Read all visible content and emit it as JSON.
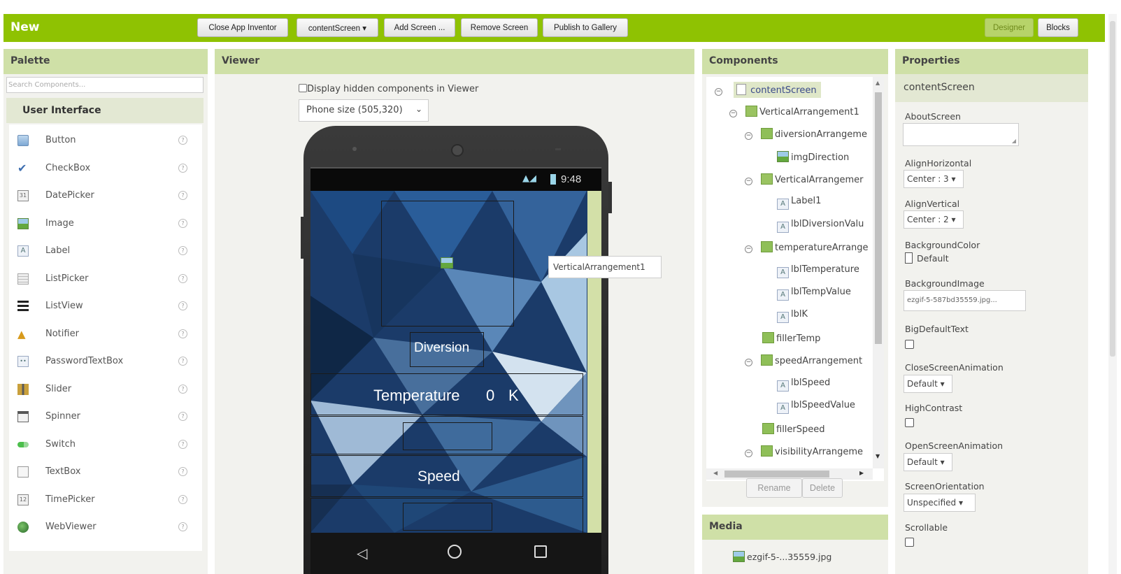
{
  "toolbar": {
    "brand": "New",
    "close_app": "Close App Inventor",
    "screen_select": "contentScreen ▾",
    "add_screen": "Add Screen ...",
    "remove_screen": "Remove Screen",
    "publish": "Publish to Gallery",
    "designer": "Designer",
    "blocks": "Blocks"
  },
  "palette": {
    "title": "Palette",
    "search_placeholder": "Search Components...",
    "category": "User Interface",
    "items": [
      {
        "label": "Button",
        "icon": "button-icon"
      },
      {
        "label": "CheckBox",
        "icon": "checkbox-icon"
      },
      {
        "label": "DatePicker",
        "icon": "datepicker-icon"
      },
      {
        "label": "Image",
        "icon": "image-icon"
      },
      {
        "label": "Label",
        "icon": "label-icon"
      },
      {
        "label": "ListPicker",
        "icon": "listpicker-icon"
      },
      {
        "label": "ListView",
        "icon": "listview-icon"
      },
      {
        "label": "Notifier",
        "icon": "notifier-icon"
      },
      {
        "label": "PasswordTextBox",
        "icon": "password-icon"
      },
      {
        "label": "Slider",
        "icon": "slider-icon"
      },
      {
        "label": "Spinner",
        "icon": "spinner-icon"
      },
      {
        "label": "Switch",
        "icon": "switch-icon"
      },
      {
        "label": "TextBox",
        "icon": "textbox-icon"
      },
      {
        "label": "TimePicker",
        "icon": "timepicker-icon"
      },
      {
        "label": "WebViewer",
        "icon": "webviewer-icon"
      }
    ]
  },
  "viewer": {
    "title": "Viewer",
    "display_hidden": "Display hidden components in Viewer",
    "phone_size": "Phone size (505,320)",
    "status_time": "9:48",
    "diversion_label": "Diversion",
    "temperature_label": "Temperature",
    "temperature_value": "0",
    "temperature_unit": "K",
    "speed_label": "Speed",
    "tooltip": "VerticalArrangement1"
  },
  "components": {
    "title": "Components",
    "tree": [
      {
        "label": "contentScreen",
        "type": "screen",
        "toggle": "⊟"
      },
      {
        "label": "VerticalArrangement1",
        "type": "varr",
        "toggle": "⊟"
      },
      {
        "label": "diversionArrangeme",
        "type": "arr",
        "toggle": "⊟"
      },
      {
        "label": "imgDirection",
        "type": "img",
        "toggle": ""
      },
      {
        "label": "VerticalArrangemer",
        "type": "varr",
        "toggle": "⊟"
      },
      {
        "label": "Label1",
        "type": "lab",
        "toggle": ""
      },
      {
        "label": "lblDiversionValu",
        "type": "lab",
        "toggle": ""
      },
      {
        "label": "temperatureArrange",
        "type": "arr",
        "toggle": "⊟"
      },
      {
        "label": "lblTemperature",
        "type": "lab",
        "toggle": ""
      },
      {
        "label": "lblTempValue",
        "type": "lab",
        "toggle": ""
      },
      {
        "label": "lblK",
        "type": "lab",
        "toggle": ""
      },
      {
        "label": "fillerTemp",
        "type": "arr",
        "toggle": ""
      },
      {
        "label": "speedArrangement",
        "type": "arr",
        "toggle": "⊟"
      },
      {
        "label": "lblSpeed",
        "type": "lab",
        "toggle": ""
      },
      {
        "label": "lblSpeedValue",
        "type": "lab",
        "toggle": ""
      },
      {
        "label": "fillerSpeed",
        "type": "arr",
        "toggle": ""
      },
      {
        "label": "visibilityArrangeme",
        "type": "arr",
        "toggle": "⊟"
      }
    ],
    "rename": "Rename",
    "delete": "Delete"
  },
  "media": {
    "title": "Media",
    "file": "ezgif-5-...35559.jpg"
  },
  "properties": {
    "title": "Properties",
    "component": "contentScreen",
    "about_screen": "AboutScreen",
    "align_horizontal": "AlignHorizontal",
    "align_horizontal_value": "Center : 3 ▾",
    "align_vertical": "AlignVertical",
    "align_vertical_value": "Center : 2 ▾",
    "background_color": "BackgroundColor",
    "background_color_value": "Default",
    "background_image": "BackgroundImage",
    "background_image_value": "ezgif-5-587bd35559.jpg...",
    "big_default_text": "BigDefaultText",
    "close_screen_animation": "CloseScreenAnimation",
    "close_screen_animation_value": "Default ▾",
    "high_contrast": "HighContrast",
    "open_screen_animation": "OpenScreenAnimation",
    "open_screen_animation_value": "Default ▾",
    "screen_orientation": "ScreenOrientation",
    "screen_orientation_value": "Unspecified ▾",
    "scrollable": "Scrollable"
  },
  "colors": {
    "brand_green": "#8fc202",
    "panel_header": "#cfe0a7",
    "panel_bg": "#f2f2ee"
  }
}
